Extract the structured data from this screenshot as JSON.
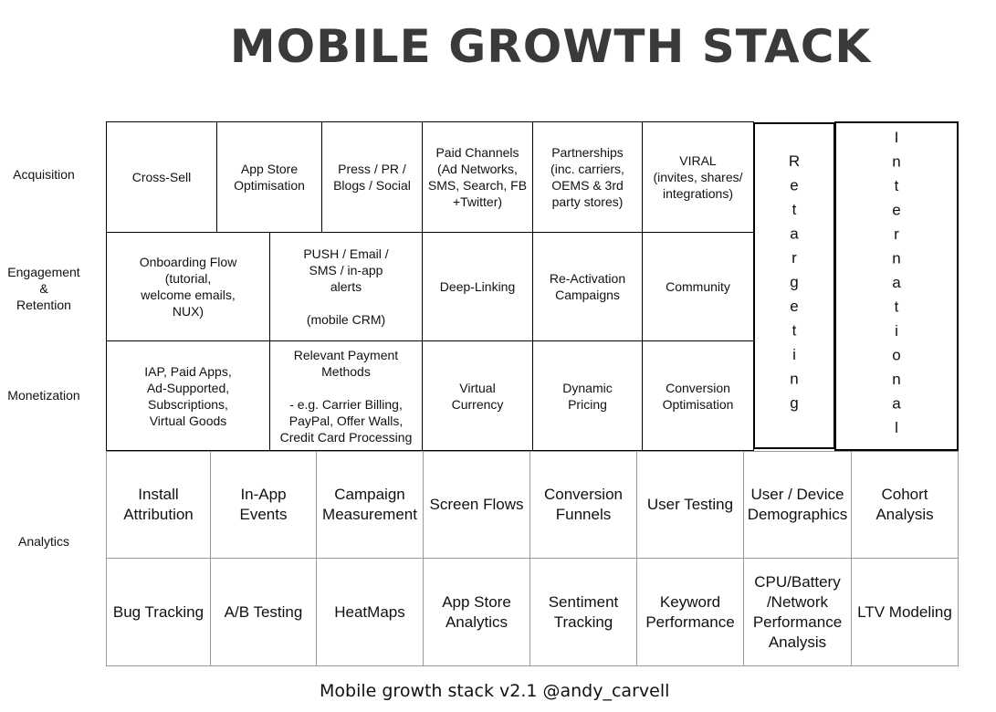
{
  "title": "MOBILE GROWTH STACK",
  "row_labels": {
    "acquisition": "Acquisition",
    "engagement": "Engagement\n&\nRetention",
    "monetization": "Monetization",
    "analytics": "Analytics"
  },
  "acquisition": [
    "Cross-Sell",
    "App Store\nOptimisation",
    "Press / PR /\nBlogs / Social",
    "Paid Channels\n(Ad Networks,\nSMS, Search, FB\n+Twitter)",
    "Partnerships\n(inc. carriers,\nOEMS & 3rd\nparty stores)",
    "VIRAL\n(invites, shares/\nintegrations)"
  ],
  "engagement": [
    "Onboarding Flow\n(tutorial,\nwelcome emails,\nNUX)",
    "PUSH / Email /\nSMS / in-app\nalerts\n\n(mobile CRM)",
    "Deep-Linking",
    "Re-Activation\nCampaigns",
    "Community"
  ],
  "monetization": [
    "IAP, Paid Apps,\nAd-Supported,\nSubscriptions,\nVirtual Goods",
    "Relevant Payment\nMethods\n\n- e.g. Carrier Billing,\nPayPal, Offer Walls,\nCredit Card Processing",
    "Virtual\nCurrency",
    "Dynamic\nPricing",
    "Conversion\nOptimisation"
  ],
  "retargeting": "Retargeting",
  "international": "International",
  "analytics_row1": [
    "Install\nAttribution",
    "In-App\nEvents",
    "Campaign\nMeasurement",
    "Screen Flows",
    "Conversion\nFunnels",
    "User Testing",
    "User / Device\nDemographics",
    "Cohort\nAnalysis"
  ],
  "analytics_row2": [
    "Bug Tracking",
    "A/B Testing",
    "HeatMaps",
    "App Store\nAnalytics",
    "Sentiment\nTracking",
    "Keyword\nPerformance",
    "CPU/Battery\n/Network\nPerformance\nAnalysis",
    "LTV Modeling"
  ],
  "footer": "Mobile growth stack v2.1  @andy_carvell"
}
